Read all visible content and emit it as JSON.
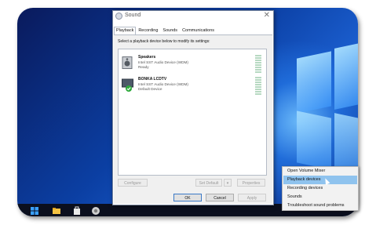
{
  "dialog": {
    "title": "Sound",
    "close_glyph": "✕",
    "tabs": [
      "Playback",
      "Recording",
      "Sounds",
      "Communications"
    ],
    "instruction": "Select a playback device below to modify its settings:",
    "devices": [
      {
        "name": "Speakers",
        "description": "Intel SST Audio Device (WDM)",
        "status": "Ready",
        "icon": "speaker-icon"
      },
      {
        "name": "BONKA LCDTV",
        "description": "Intel SST Audio Device (WDM)",
        "status": "Default Device",
        "icon": "monitor-default-icon"
      }
    ],
    "buttons": {
      "configure": "Configure",
      "set_default": "Set Default",
      "dropdown_glyph": "▾",
      "properties": "Properties",
      "ok": "OK",
      "cancel": "Cancel",
      "apply": "Apply"
    }
  },
  "context_menu": {
    "items": [
      "Open Volume Mixer",
      "Playback devices",
      "Recording devices",
      "Sounds",
      "Troubleshoot sound problems"
    ],
    "highlighted": "Playback devices"
  },
  "taskbar": {
    "icons": [
      "windows-start-icon",
      "file-explorer-icon",
      "store-icon",
      "chrome-icon"
    ]
  },
  "colors": {
    "desktop": "#0b3fa3",
    "highlight": "#8fc3ee",
    "taskbar": "#0b0f1e"
  }
}
